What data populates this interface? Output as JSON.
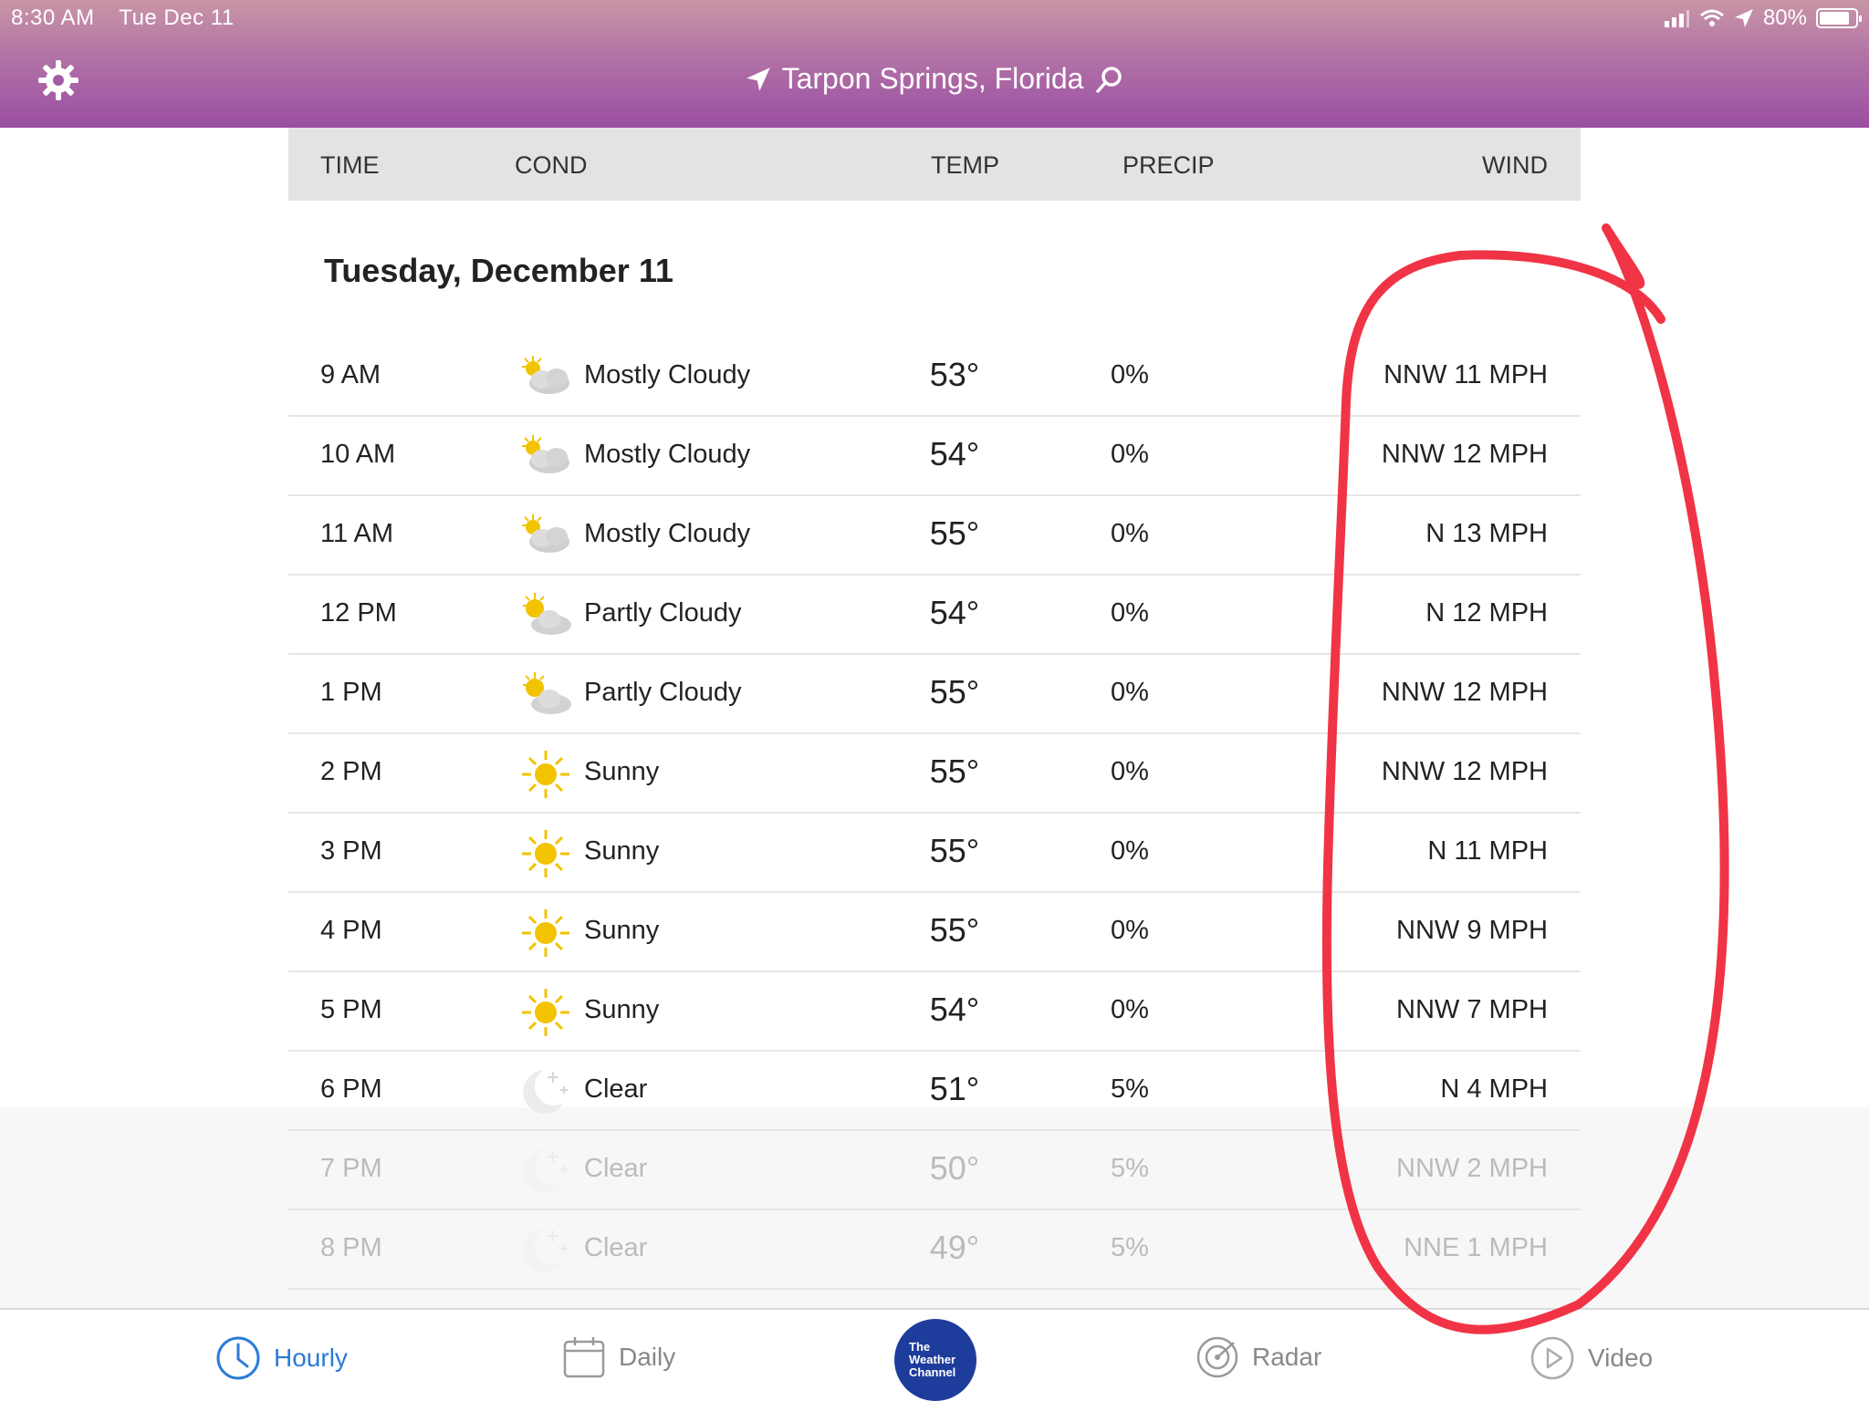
{
  "status_bar": {
    "time": "8:30 AM",
    "date": "Tue Dec 11",
    "battery": "80%"
  },
  "header": {
    "location": "Tarpon Springs, Florida"
  },
  "table": {
    "columns": {
      "time": "TIME",
      "cond": "COND",
      "temp": "TEMP",
      "precip": "PRECIP",
      "wind": "WIND"
    },
    "day_title": "Tuesday, December 11",
    "rows": [
      {
        "time": "9 AM",
        "icon": "mostly-cloudy-icon",
        "cond": "Mostly Cloudy",
        "temp": "53°",
        "precip": "0%",
        "wind": "NNW 11 MPH"
      },
      {
        "time": "10 AM",
        "icon": "mostly-cloudy-icon",
        "cond": "Mostly Cloudy",
        "temp": "54°",
        "precip": "0%",
        "wind": "NNW 12 MPH"
      },
      {
        "time": "11 AM",
        "icon": "mostly-cloudy-icon",
        "cond": "Mostly Cloudy",
        "temp": "55°",
        "precip": "0%",
        "wind": "N 13 MPH"
      },
      {
        "time": "12 PM",
        "icon": "partly-cloudy-icon",
        "cond": "Partly Cloudy",
        "temp": "54°",
        "precip": "0%",
        "wind": "N 12 MPH"
      },
      {
        "time": "1 PM",
        "icon": "partly-cloudy-icon",
        "cond": "Partly Cloudy",
        "temp": "55°",
        "precip": "0%",
        "wind": "NNW 12 MPH"
      },
      {
        "time": "2 PM",
        "icon": "sunny-icon",
        "cond": "Sunny",
        "temp": "55°",
        "precip": "0%",
        "wind": "NNW 12 MPH"
      },
      {
        "time": "3 PM",
        "icon": "sunny-icon",
        "cond": "Sunny",
        "temp": "55°",
        "precip": "0%",
        "wind": "N 11 MPH"
      },
      {
        "time": "4 PM",
        "icon": "sunny-icon",
        "cond": "Sunny",
        "temp": "55°",
        "precip": "0%",
        "wind": "NNW 9 MPH"
      },
      {
        "time": "5 PM",
        "icon": "sunny-icon",
        "cond": "Sunny",
        "temp": "54°",
        "precip": "0%",
        "wind": "NNW 7 MPH"
      },
      {
        "time": "6 PM",
        "icon": "clear-night-icon",
        "cond": "Clear",
        "temp": "51°",
        "precip": "5%",
        "wind": "N 4 MPH"
      },
      {
        "time": "7 PM",
        "icon": "clear-night-icon",
        "cond": "Clear",
        "temp": "50°",
        "precip": "5%",
        "wind": "NNW 2 MPH"
      },
      {
        "time": "8 PM",
        "icon": "clear-night-icon",
        "cond": "Clear",
        "temp": "49°",
        "precip": "5%",
        "wind": "NNE 1 MPH"
      }
    ]
  },
  "tabbar": {
    "hourly": "Hourly",
    "daily": "Daily",
    "logo": [
      "The",
      "Weather",
      "Channel"
    ],
    "radar": "Radar",
    "video": "Video"
  },
  "colors": {
    "accent": "#2a7bd8",
    "annotation": "#f03445",
    "header_top": "#c996a6",
    "header_bottom": "#9a4ea2"
  }
}
